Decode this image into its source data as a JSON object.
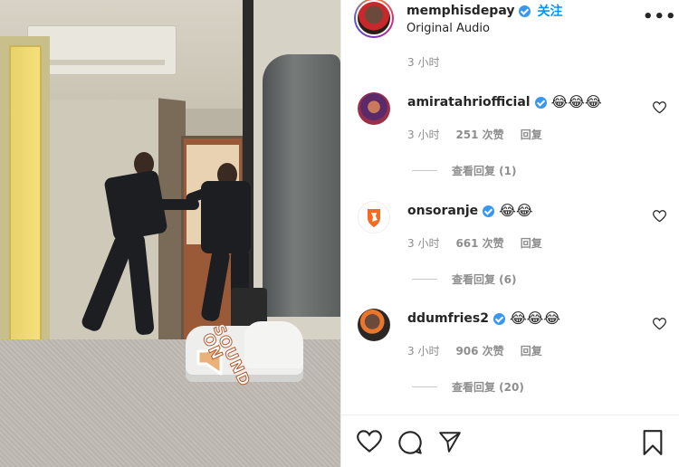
{
  "post": {
    "username": "memphisdepay",
    "follow_label": "关注",
    "audio_label": "Original Audio",
    "caption_time": "3 小时",
    "more_icon": "more-horizontal-icon"
  },
  "video": {
    "sound_badge_line1": "SOUND",
    "sound_badge_line2": "ON",
    "sound_icon": "speaker-icon"
  },
  "comments": [
    {
      "username": "amiratahriofficial",
      "text": "😂😂😂",
      "time": "3 小时",
      "likes": "251 次赞",
      "reply_label": "回复",
      "view_replies": "查看回复 (1)"
    },
    {
      "username": "onsoranje",
      "text": "😂😂",
      "time": "3 小时",
      "likes": "661 次赞",
      "reply_label": "回复",
      "view_replies": "查看回复 (6)"
    },
    {
      "username": "ddumfries2",
      "text": "😂😂😂",
      "time": "3 小时",
      "likes": "906 次赞",
      "reply_label": "回复",
      "view_replies": "查看回复 (20)"
    }
  ],
  "actions": {
    "like_icon": "heart-icon",
    "comment_icon": "comment-icon",
    "share_icon": "send-icon",
    "save_icon": "bookmark-icon"
  },
  "colors": {
    "accent": "#0095f6",
    "verified": "#3897f0",
    "muted": "#8e8e8e",
    "text": "#262626"
  }
}
